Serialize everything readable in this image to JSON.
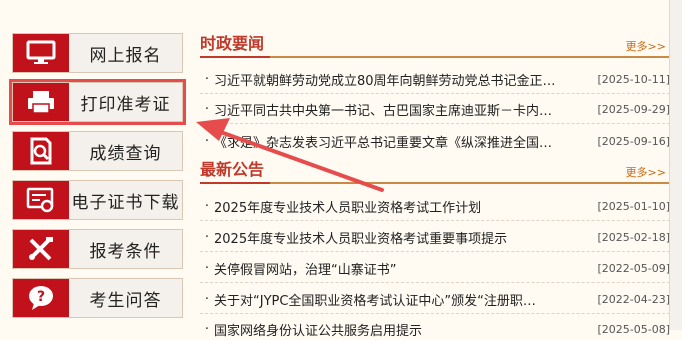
{
  "menu": [
    {
      "label": "网上报名",
      "icon": "monitor-icon"
    },
    {
      "label": "打印准考证",
      "icon": "printer-icon"
    },
    {
      "label": "成绩查询",
      "icon": "document-search-icon"
    },
    {
      "label": "电子证书下载",
      "icon": "certificate-icon"
    },
    {
      "label": "报考条件",
      "icon": "tools-icon"
    },
    {
      "label": "考生问答",
      "icon": "question-icon"
    }
  ],
  "news": {
    "title": "时政要闻",
    "more": "更多>>",
    "items": [
      {
        "text": "习近平就朝鲜劳动党成立80周年向朝鲜劳动党总书记金正…",
        "date": "[2025-10-11]"
      },
      {
        "text": "习近平同古共中央第一书记、古巴国家主席迪亚斯－卡内…",
        "date": "[2025-09-29]"
      },
      {
        "text": "《求是》杂志发表习近平总书记重要文章《纵深推进全国…",
        "date": "[2025-09-16]"
      }
    ]
  },
  "notice": {
    "title": "最新公告",
    "more": "更多>>",
    "items": [
      {
        "text": "2025年度专业技术人员职业资格考试工作计划",
        "date": "[2025-01-10]"
      },
      {
        "text": "2025年度专业技术人员职业资格考试重要事项提示",
        "date": "[2025-02-18]"
      },
      {
        "text": "关停假冒网站，治理“山寨证书”",
        "date": "[2022-05-09]"
      },
      {
        "text": "关于对“JYPC全国职业资格考试认证中心”颁发“注册职…",
        "date": "[2022-04-23]"
      },
      {
        "text": "国家网络身份认证公共服务启用提示",
        "date": "[2025-05-08]"
      }
    ]
  },
  "colors": {
    "accent": "#c1121b",
    "highlight": "#e74c4c"
  }
}
